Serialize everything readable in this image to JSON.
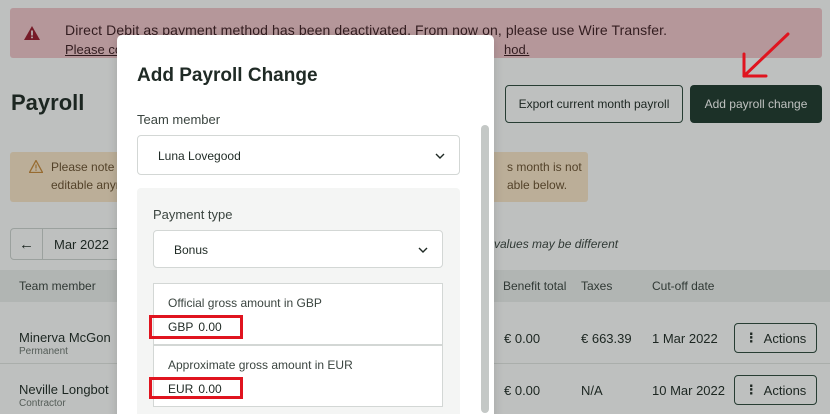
{
  "banner": {
    "line1": "Direct Debit as payment method has been deactivated. From now on, please use Wire Transfer.",
    "line2_left": "Please co",
    "line2_right": "hod."
  },
  "page": {
    "title": "Payroll",
    "export_button": "Export current month payroll",
    "add_button": "Add payroll change"
  },
  "warning": {
    "line1_left": "Please note th",
    "line1_right": "s month is not",
    "line2_left": "editable anym",
    "line2_right": "able below."
  },
  "month_nav": {
    "prev_glyph": "←",
    "month": "Mar 2022"
  },
  "note": "e values may be different",
  "table": {
    "headers": {
      "team_member": "Team member",
      "benefit_total": "Benefit total",
      "taxes": "Taxes",
      "cutoff": "Cut-off date"
    },
    "rows": [
      {
        "name": "Minerva McGon",
        "type": "Permanent",
        "benefit": "€ 0.00",
        "taxes": "€ 663.39",
        "cutoff": "1 Mar 2022",
        "action": "Actions"
      },
      {
        "name": "Neville Longbot",
        "type": "Contractor",
        "benefit": "€ 0.00",
        "taxes": "N/A",
        "cutoff": "10 Mar 2022",
        "action": "Actions"
      }
    ],
    "kebab_glyph": "⋮"
  },
  "modal": {
    "title": "Add Payroll Change",
    "team_member_label": "Team member",
    "team_member_value": "Luna Lovegood",
    "payment_type_label": "Payment type",
    "payment_type_value": "Bonus",
    "gbp_label": "Official gross amount in GBP",
    "gbp_currency": "GBP",
    "gbp_amount": "0.00",
    "eur_label": "Approximate gross amount in EUR",
    "eur_currency": "EUR",
    "eur_amount": "0.00"
  },
  "colors": {
    "primary": "#1f3a2e",
    "danger_banner": "#f3c7cc",
    "warning_banner": "#fbe6c9",
    "annotation_red": "#e0141f"
  }
}
